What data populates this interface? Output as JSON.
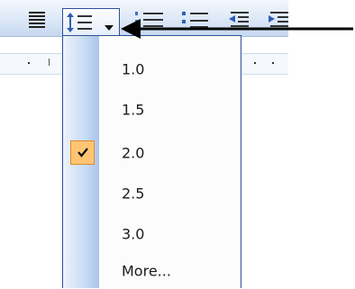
{
  "toolbar": {
    "icons": [
      "justify-icon",
      "line-spacing-icon",
      "numbering-icon",
      "bullets-icon",
      "decrease-indent-icon",
      "increase-indent-icon"
    ]
  },
  "line_spacing_menu": {
    "items": [
      {
        "label": "1.0",
        "checked": false
      },
      {
        "label": "1.5",
        "checked": false
      },
      {
        "label": "2.0",
        "checked": true
      },
      {
        "label": "2.5",
        "checked": false
      },
      {
        "label": "3.0",
        "checked": false
      },
      {
        "label": "More...",
        "checked": false
      }
    ]
  },
  "colors": {
    "menu_border": "#2e4f9a",
    "check_fill": "#ffc573",
    "check_border": "#e08a2c",
    "arrow": "#000000"
  }
}
